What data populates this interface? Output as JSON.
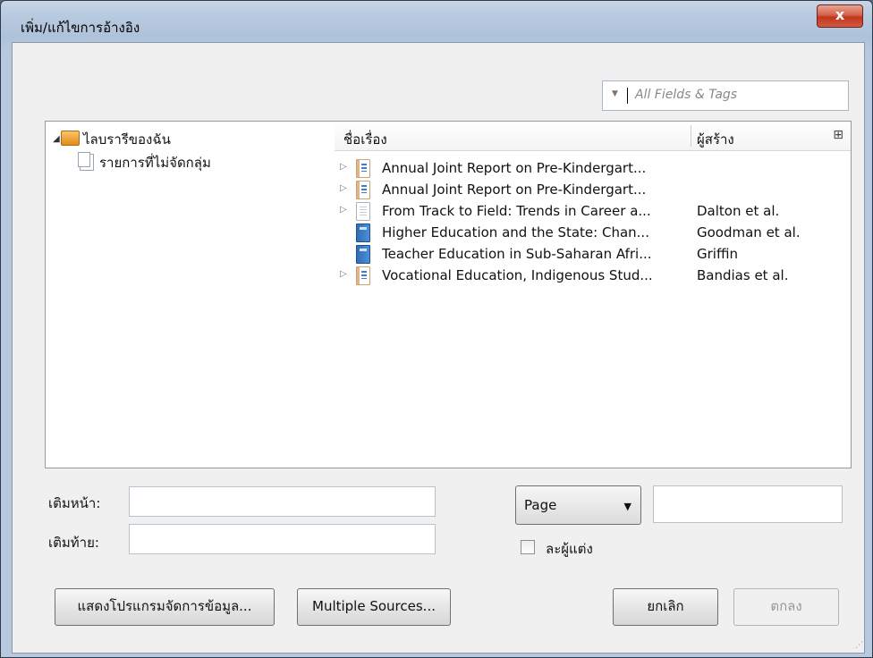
{
  "window": {
    "title": "เพิ่ม/แก้ไขการอ้างอิง",
    "close_label": "x"
  },
  "search": {
    "placeholder": "All Fields & Tags"
  },
  "library": {
    "root_label": "ไลบรารีของฉัน",
    "unfiled_label": "รายการที่ไม่จัดกลุ่ม"
  },
  "items_table": {
    "column_title": "ชื่อเรื่อง",
    "column_creator": "ผู้สร้าง",
    "rows": [
      {
        "title": "Annual Joint Report on Pre-Kindergart...",
        "creator": "",
        "icon": "report-icon",
        "expandable": true
      },
      {
        "title": "Annual Joint Report on Pre-Kindergart...",
        "creator": "",
        "icon": "report-icon",
        "expandable": true
      },
      {
        "title": "From Track to Field: Trends in Career a...",
        "creator": "Dalton et al.",
        "icon": "document-icon",
        "expandable": true
      },
      {
        "title": "Higher Education and the State: Chan...",
        "creator": "Goodman et al.",
        "icon": "book-icon",
        "expandable": false
      },
      {
        "title": "Teacher Education in Sub-Saharan Afri...",
        "creator": "Griffin",
        "icon": "book-icon",
        "expandable": false
      },
      {
        "title": "Vocational Education, Indigenous Stud...",
        "creator": "Bandias et al.",
        "icon": "report-icon",
        "expandable": true
      }
    ]
  },
  "citation_options": {
    "prefix_label": "เติมหน้า:",
    "prefix_value": "",
    "suffix_label": "เติมท้าย:",
    "suffix_value": "",
    "locator_type": "Page",
    "locator_value": "",
    "omit_author_label": "ละผู้แต่ง",
    "omit_author_checked": false
  },
  "buttons": {
    "show_editor": "แสดงโปรแกรมจัดการข้อมูล...",
    "multiple_sources": "Multiple Sources...",
    "cancel": "ยกเลิก",
    "ok": "ตกลง"
  }
}
